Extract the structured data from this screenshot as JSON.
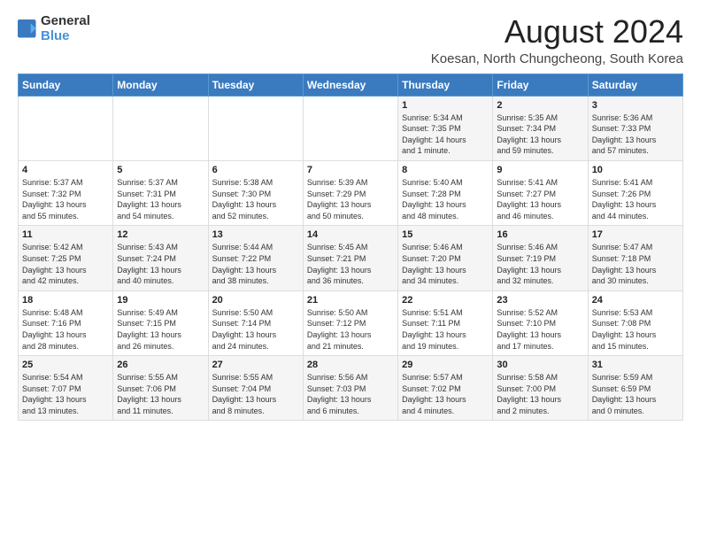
{
  "logo": {
    "general": "General",
    "blue": "Blue"
  },
  "title": "August 2024",
  "subtitle": "Koesan, North Chungcheong, South Korea",
  "days_of_week": [
    "Sunday",
    "Monday",
    "Tuesday",
    "Wednesday",
    "Thursday",
    "Friday",
    "Saturday"
  ],
  "weeks": [
    [
      {
        "day": "",
        "content": ""
      },
      {
        "day": "",
        "content": ""
      },
      {
        "day": "",
        "content": ""
      },
      {
        "day": "",
        "content": ""
      },
      {
        "day": "1",
        "content": "Sunrise: 5:34 AM\nSunset: 7:35 PM\nDaylight: 14 hours\nand 1 minute."
      },
      {
        "day": "2",
        "content": "Sunrise: 5:35 AM\nSunset: 7:34 PM\nDaylight: 13 hours\nand 59 minutes."
      },
      {
        "day": "3",
        "content": "Sunrise: 5:36 AM\nSunset: 7:33 PM\nDaylight: 13 hours\nand 57 minutes."
      }
    ],
    [
      {
        "day": "4",
        "content": "Sunrise: 5:37 AM\nSunset: 7:32 PM\nDaylight: 13 hours\nand 55 minutes."
      },
      {
        "day": "5",
        "content": "Sunrise: 5:37 AM\nSunset: 7:31 PM\nDaylight: 13 hours\nand 54 minutes."
      },
      {
        "day": "6",
        "content": "Sunrise: 5:38 AM\nSunset: 7:30 PM\nDaylight: 13 hours\nand 52 minutes."
      },
      {
        "day": "7",
        "content": "Sunrise: 5:39 AM\nSunset: 7:29 PM\nDaylight: 13 hours\nand 50 minutes."
      },
      {
        "day": "8",
        "content": "Sunrise: 5:40 AM\nSunset: 7:28 PM\nDaylight: 13 hours\nand 48 minutes."
      },
      {
        "day": "9",
        "content": "Sunrise: 5:41 AM\nSunset: 7:27 PM\nDaylight: 13 hours\nand 46 minutes."
      },
      {
        "day": "10",
        "content": "Sunrise: 5:41 AM\nSunset: 7:26 PM\nDaylight: 13 hours\nand 44 minutes."
      }
    ],
    [
      {
        "day": "11",
        "content": "Sunrise: 5:42 AM\nSunset: 7:25 PM\nDaylight: 13 hours\nand 42 minutes."
      },
      {
        "day": "12",
        "content": "Sunrise: 5:43 AM\nSunset: 7:24 PM\nDaylight: 13 hours\nand 40 minutes."
      },
      {
        "day": "13",
        "content": "Sunrise: 5:44 AM\nSunset: 7:22 PM\nDaylight: 13 hours\nand 38 minutes."
      },
      {
        "day": "14",
        "content": "Sunrise: 5:45 AM\nSunset: 7:21 PM\nDaylight: 13 hours\nand 36 minutes."
      },
      {
        "day": "15",
        "content": "Sunrise: 5:46 AM\nSunset: 7:20 PM\nDaylight: 13 hours\nand 34 minutes."
      },
      {
        "day": "16",
        "content": "Sunrise: 5:46 AM\nSunset: 7:19 PM\nDaylight: 13 hours\nand 32 minutes."
      },
      {
        "day": "17",
        "content": "Sunrise: 5:47 AM\nSunset: 7:18 PM\nDaylight: 13 hours\nand 30 minutes."
      }
    ],
    [
      {
        "day": "18",
        "content": "Sunrise: 5:48 AM\nSunset: 7:16 PM\nDaylight: 13 hours\nand 28 minutes."
      },
      {
        "day": "19",
        "content": "Sunrise: 5:49 AM\nSunset: 7:15 PM\nDaylight: 13 hours\nand 26 minutes."
      },
      {
        "day": "20",
        "content": "Sunrise: 5:50 AM\nSunset: 7:14 PM\nDaylight: 13 hours\nand 24 minutes."
      },
      {
        "day": "21",
        "content": "Sunrise: 5:50 AM\nSunset: 7:12 PM\nDaylight: 13 hours\nand 21 minutes."
      },
      {
        "day": "22",
        "content": "Sunrise: 5:51 AM\nSunset: 7:11 PM\nDaylight: 13 hours\nand 19 minutes."
      },
      {
        "day": "23",
        "content": "Sunrise: 5:52 AM\nSunset: 7:10 PM\nDaylight: 13 hours\nand 17 minutes."
      },
      {
        "day": "24",
        "content": "Sunrise: 5:53 AM\nSunset: 7:08 PM\nDaylight: 13 hours\nand 15 minutes."
      }
    ],
    [
      {
        "day": "25",
        "content": "Sunrise: 5:54 AM\nSunset: 7:07 PM\nDaylight: 13 hours\nand 13 minutes."
      },
      {
        "day": "26",
        "content": "Sunrise: 5:55 AM\nSunset: 7:06 PM\nDaylight: 13 hours\nand 11 minutes."
      },
      {
        "day": "27",
        "content": "Sunrise: 5:55 AM\nSunset: 7:04 PM\nDaylight: 13 hours\nand 8 minutes."
      },
      {
        "day": "28",
        "content": "Sunrise: 5:56 AM\nSunset: 7:03 PM\nDaylight: 13 hours\nand 6 minutes."
      },
      {
        "day": "29",
        "content": "Sunrise: 5:57 AM\nSunset: 7:02 PM\nDaylight: 13 hours\nand 4 minutes."
      },
      {
        "day": "30",
        "content": "Sunrise: 5:58 AM\nSunset: 7:00 PM\nDaylight: 13 hours\nand 2 minutes."
      },
      {
        "day": "31",
        "content": "Sunrise: 5:59 AM\nSunset: 6:59 PM\nDaylight: 13 hours\nand 0 minutes."
      }
    ]
  ]
}
